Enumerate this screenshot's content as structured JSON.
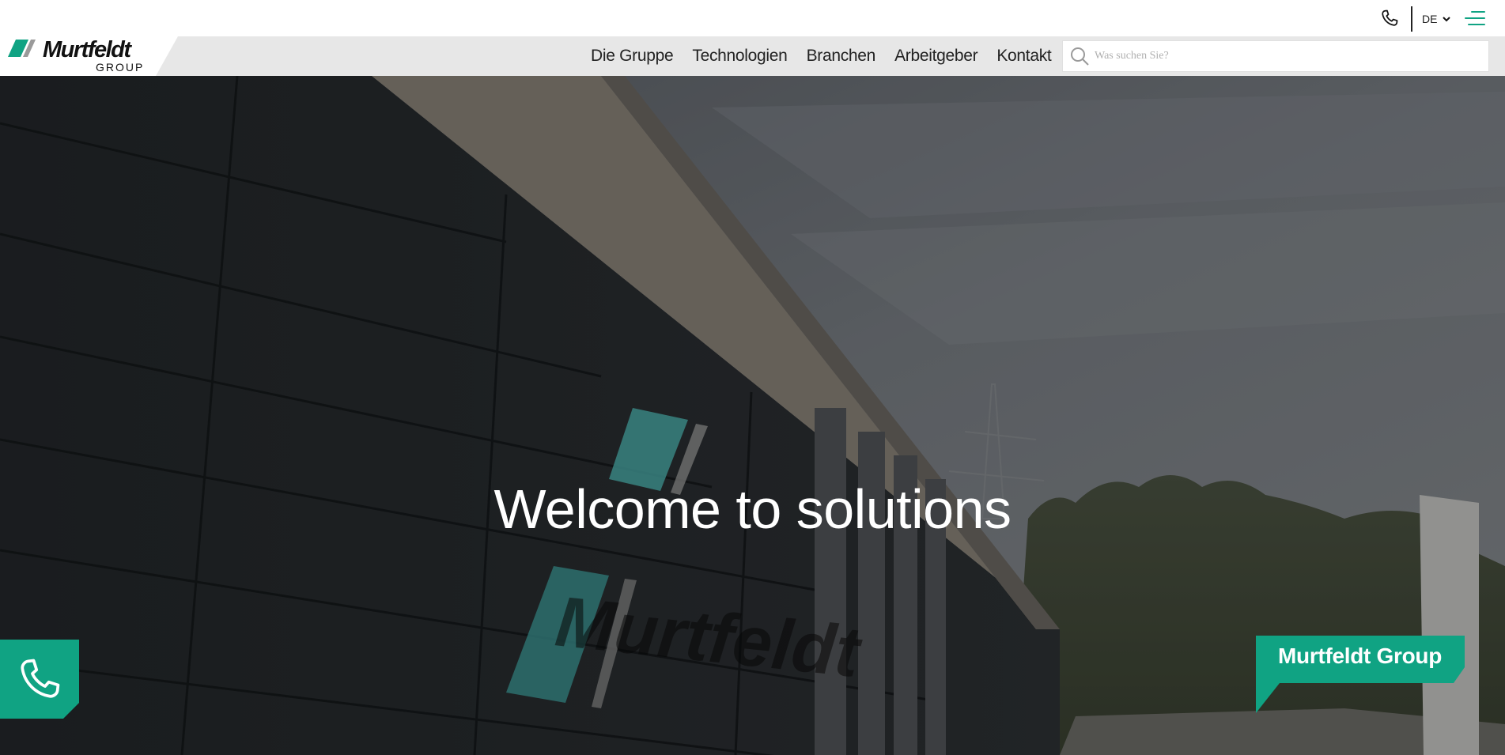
{
  "utility": {
    "phone_icon": "phone-icon",
    "language": "DE",
    "menu_icon": "hamburger-icon"
  },
  "logo": {
    "name": "Murtfeldt",
    "sub": "GROUP"
  },
  "nav": {
    "items": [
      {
        "label": "Die Gruppe"
      },
      {
        "label": "Technologien"
      },
      {
        "label": "Branchen"
      },
      {
        "label": "Arbeitgeber"
      },
      {
        "label": "Kontakt"
      }
    ]
  },
  "search": {
    "placeholder": "Was suchen Sie?",
    "value": ""
  },
  "hero": {
    "title": "Welcome to solutions",
    "call_button_icon": "phone-icon",
    "brand_tag": "Murtfeldt Group"
  },
  "colors": {
    "accent": "#10a383",
    "nav_bg": "#e7e7e7",
    "text": "#222222"
  }
}
